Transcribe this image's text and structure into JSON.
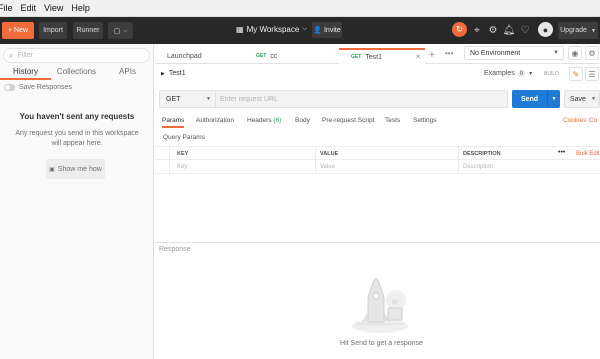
{
  "menu": [
    "File",
    "Edit",
    "View",
    "Help"
  ],
  "toolbar": {
    "new_label": "New",
    "import_label": "Import",
    "runner_label": "Runner",
    "workspace_label": "My Workspace",
    "invite_label": "Invite",
    "upgrade_label": "Upgrade"
  },
  "sidebar": {
    "filter_placeholder": "Filter",
    "tabs": [
      "History",
      "Collections",
      "APIs"
    ],
    "save_responses_label": "Save Responses",
    "empty_title": "You haven't sent any requests",
    "empty_desc": "Any request you send in this workspace will appear here.",
    "show_me_label": "Show me how"
  },
  "tabs": [
    {
      "method": "",
      "label": "Launchpad"
    },
    {
      "method": "GET",
      "label": "cc"
    },
    {
      "method": "GET",
      "label": "Test1"
    }
  ],
  "environment": "No Environment",
  "request": {
    "name": "Test1",
    "examples_label": "Examples",
    "examples_count": "0",
    "build_label": "BUILD",
    "method": "GET",
    "url_placeholder": "Enter request URL",
    "send_label": "Send",
    "save_label": "Save"
  },
  "subtabs": {
    "params": "Params",
    "authorization": "Authorization",
    "headers": "Headers",
    "headers_count": "(6)",
    "body": "Body",
    "prerequest": "Pre-request Script",
    "tests": "Tests",
    "settings": "Settings",
    "cookies": "Cookies",
    "code": "Co"
  },
  "params": {
    "section_label": "Query Params",
    "columns": {
      "key": "KEY",
      "value": "VALUE",
      "description": "DESCRIPTION"
    },
    "more_label": "•••",
    "bulk_edit": "Bulk Edit",
    "row_placeholders": {
      "key": "Key",
      "value": "Value",
      "description": "Description"
    }
  },
  "response": {
    "label": "Response",
    "hint": "Hit Send to get a response"
  },
  "colors": {
    "accent": "#f26b3a",
    "send": "#1f7bd6",
    "toolbar": "#282828",
    "get_method": "#2e9e5b"
  }
}
